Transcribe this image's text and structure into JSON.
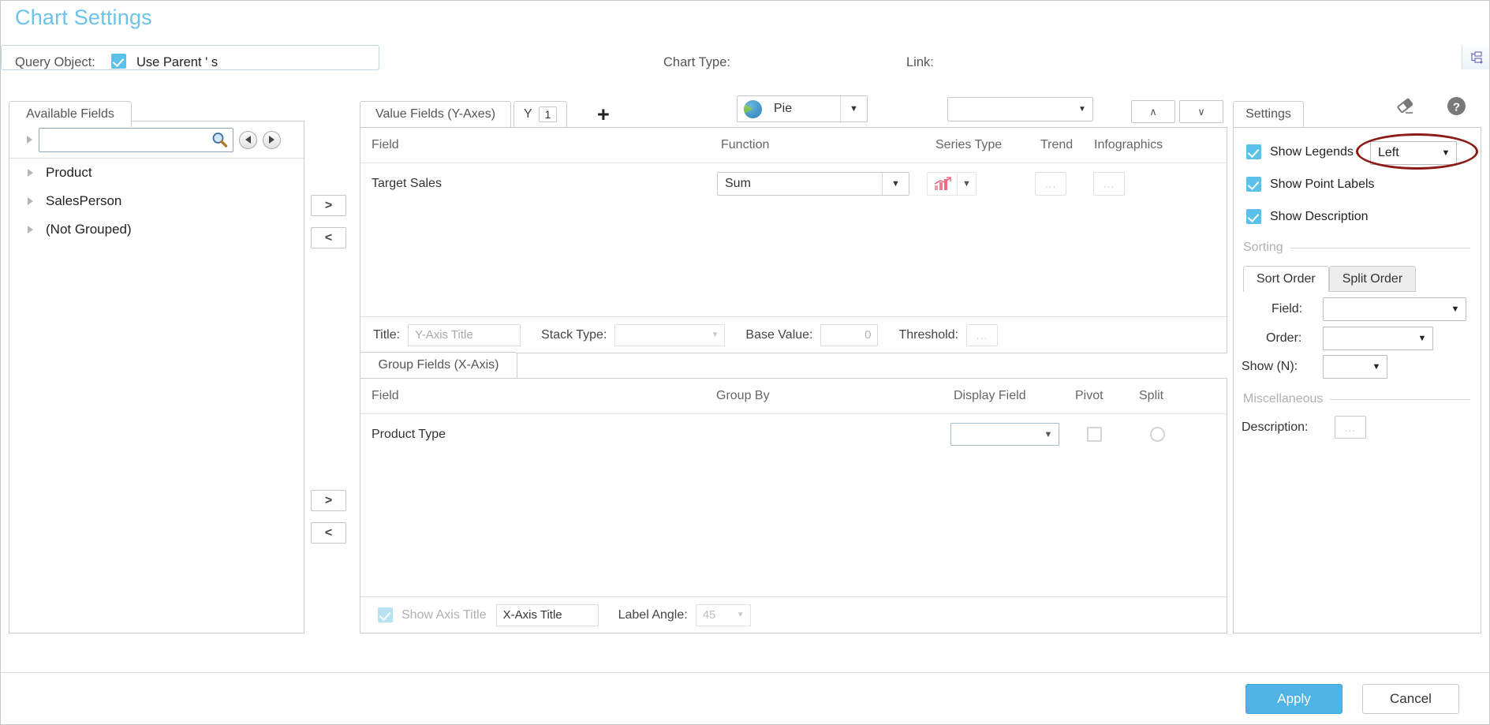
{
  "page": {
    "title": "Chart Settings"
  },
  "toolbar": {
    "query_object_label": "Query Object:",
    "use_parents_label": "Use Parent ' s",
    "query_value": "",
    "query_picker_icon": "tree-picker-icon",
    "chart_type_label": "Chart Type:",
    "chart_type_value": "Pie",
    "chart_type_icon": "pie-chart-icon",
    "link_label": "Link:",
    "link_value": "",
    "eraser_icon": "eraser-icon",
    "help_icon": "help-icon"
  },
  "available_fields": {
    "tab_label": "Available Fields",
    "search_placeholder": "",
    "search_value": "",
    "search_icon": "search-icon",
    "back_icon": "nav-back-icon",
    "forward_icon": "nav-forward-icon",
    "items": [
      {
        "label": "Product"
      },
      {
        "label": "SalesPerson"
      },
      {
        "label": "(Not Grouped)"
      }
    ]
  },
  "transfer": {
    "add_label": ">",
    "remove_label": "<"
  },
  "value_fields": {
    "tab_label": "Value Fields (Y-Axes)",
    "y_tab_label": "Y",
    "y_tab_index": "1",
    "add_axis_label": "+",
    "move_up_label": "∧",
    "move_down_label": "∨",
    "columns": [
      "Field",
      "Function",
      "Series Type",
      "Trend",
      "Infographics"
    ],
    "rows": [
      {
        "field": "Target Sales",
        "function": "Sum",
        "series_type_icon": "bar-trend-chart-icon",
        "trend": "...",
        "infographics": "..."
      }
    ],
    "footer": {
      "title_label": "Title:",
      "title_placeholder": "Y-Axis Title",
      "title_value": "",
      "stack_type_label": "Stack Type:",
      "stack_type_value": "",
      "base_value_label": "Base Value:",
      "base_value": "0",
      "threshold_label": "Threshold:",
      "threshold_value": "..."
    }
  },
  "group_fields": {
    "tab_label": "Group Fields (X-Axis)",
    "columns": [
      "Field",
      "Group By",
      "Display Field",
      "Pivot",
      "Split"
    ],
    "rows": [
      {
        "field": "Product Type",
        "group_by": "",
        "display_field": "",
        "pivot_checked": false,
        "split_checked": false
      }
    ],
    "footer": {
      "show_axis_title_label": "Show Axis Title",
      "show_axis_title_checked": true,
      "axis_title_value": "X-Axis Title",
      "label_angle_label": "Label Angle:",
      "label_angle_value": "45"
    }
  },
  "settings": {
    "tab_label": "Settings",
    "show_legends_label": "Show Legends",
    "show_legends_checked": true,
    "legend_position_value": "Left",
    "show_point_labels_label": "Show Point Labels",
    "show_point_labels_checked": true,
    "show_description_label": "Show Description",
    "show_description_checked": true,
    "sorting_section_label": "Sorting",
    "sort_order_tab": "Sort Order",
    "split_order_tab": "Split Order",
    "field_label": "Field:",
    "field_value": "",
    "order_label": "Order:",
    "order_value": "",
    "show_n_label": "Show (N):",
    "show_n_value": "",
    "misc_section_label": "Miscellaneous",
    "description_label": "Description:",
    "description_value": "..."
  },
  "actions": {
    "apply_label": "Apply",
    "cancel_label": "Cancel"
  },
  "annotation": {
    "highlight_color": "#8c1a16",
    "highlight_target": "legend-position-select"
  }
}
